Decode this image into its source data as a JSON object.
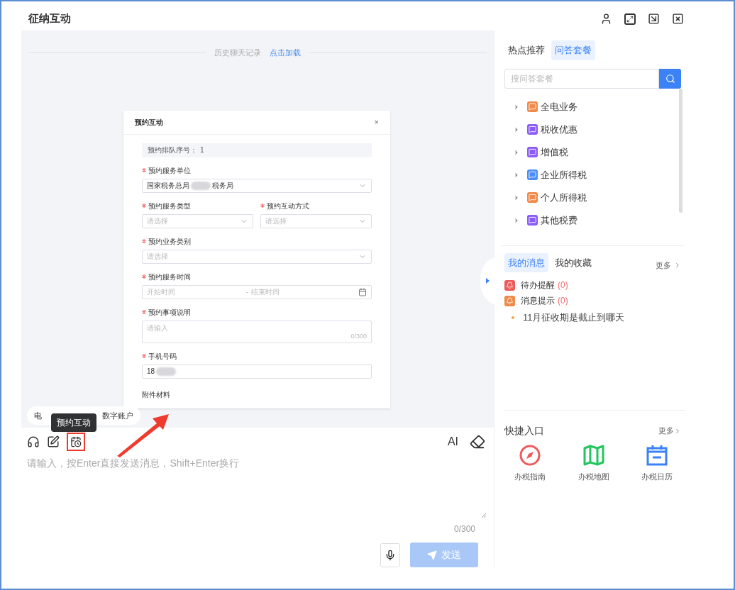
{
  "window": {
    "title": "征纳互动"
  },
  "chat": {
    "history_label": "历史聊天记录",
    "history_link": "点击加载",
    "embedded_dialog": {
      "title": "预约互动",
      "close": "×",
      "info_label": "预约排队序号：",
      "info_value": "1",
      "fields": [
        {
          "kind": "select",
          "label": "预约服务单位",
          "required": true,
          "value": "国家税务总局",
          "value_after": "税务局",
          "masked": true
        },
        {
          "kind": "select_pair",
          "label": "预约服务类型",
          "required": true,
          "placeholder": "请选择",
          "label_2": "预约互动方式",
          "placeholder_2": "请选择"
        },
        {
          "kind": "select",
          "label": "预约业务类别",
          "required": true,
          "placeholder": "请选择"
        },
        {
          "kind": "date_range",
          "label": "预约服务时间",
          "required": true,
          "placeholder": "开始时间",
          "separator": "-",
          "placeholder_2": "结束时间"
        },
        {
          "kind": "textarea",
          "label": "预约事项说明",
          "required": true,
          "placeholder": "请输入",
          "counter": "0/300"
        },
        {
          "kind": "input",
          "label": "手机号码",
          "required": true,
          "value": "18",
          "masked": true
        },
        {
          "kind": "label",
          "label": "附件材料",
          "required": false
        }
      ]
    }
  },
  "chip": {
    "text_start": "电",
    "text_end": "数字账户"
  },
  "tooltip": "预约互动",
  "composer": {
    "ai_label": "AI",
    "placeholder": "请输入，按Enter直接发送消息，Shift+Enter换行",
    "counter": "0/300",
    "send": {
      "label": "发送",
      "disabled": true
    }
  },
  "right_panel": {
    "tabs": [
      {
        "label": "热点推荐",
        "selected": false
      },
      {
        "label": "问答套餐",
        "selected": true
      }
    ],
    "search": {
      "placeholder": "搜问答套餐"
    },
    "tree": [
      {
        "label": "全电业务",
        "color": "#f08a4b",
        "expanded": false
      },
      {
        "label": "税收优惠",
        "color": "#8b5cf6",
        "expanded": false
      },
      {
        "label": "增值税",
        "color": "#8b5cf6",
        "expanded": false
      },
      {
        "label": "企业所得税",
        "color": "#4b8ef5",
        "expanded": false
      },
      {
        "label": "个人所得税",
        "color": "#f08a4b",
        "expanded": false
      },
      {
        "label": "其他税费",
        "color": "#8b5cf6",
        "expanded": false
      }
    ],
    "message_tabs": [
      {
        "label": "我的消息",
        "selected": true
      },
      {
        "label": "我的收藏",
        "selected": false
      }
    ],
    "message_more": "更多",
    "messages": [
      {
        "label": "待办提醒",
        "count": "(0)",
        "color": "#ef5a5a"
      },
      {
        "label": "消息提示",
        "count": "(0)",
        "color": "#f08a4b"
      }
    ],
    "notices": [
      "11月征收期是截止到哪天"
    ],
    "quick_title": "快捷入口",
    "quick_more": "更多",
    "quick": [
      {
        "label": "办税指南",
        "kind": "compass",
        "color": "#ef5a5a"
      },
      {
        "label": "办税地图",
        "kind": "map",
        "color": "#22c55e"
      },
      {
        "label": "办税日历",
        "kind": "calendar",
        "color": "#3b82f6"
      }
    ]
  }
}
